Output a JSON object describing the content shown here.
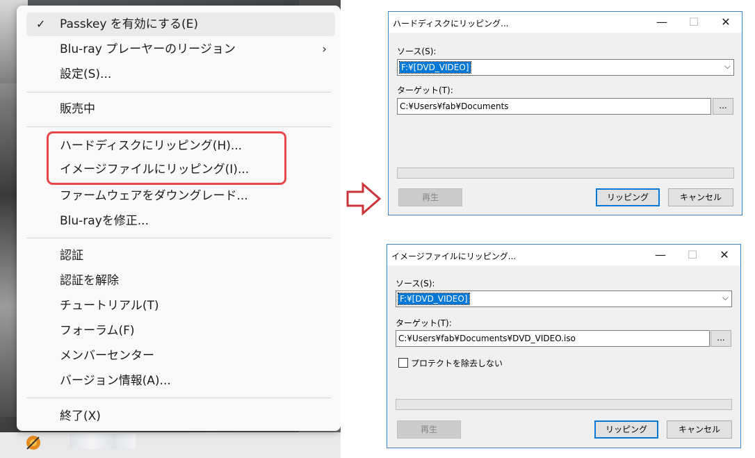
{
  "menu": {
    "items": [
      {
        "label": "Passkey を有効にする(E)",
        "checked": true
      },
      {
        "label": "Blu-ray プレーヤーのリージョン",
        "submenu": true
      },
      {
        "label": "設定(S)..."
      },
      {
        "label": "販売中"
      },
      {
        "label": "ハードディスクにリッピング(H)..."
      },
      {
        "label": "イメージファイルにリッピング(I)..."
      },
      {
        "label": "ファームウェアをダウングレード..."
      },
      {
        "label": "Blu-rayを修正..."
      },
      {
        "label": "認証"
      },
      {
        "label": "認証を解除"
      },
      {
        "label": "チュートリアル(T)"
      },
      {
        "label": "フォーラム(F)"
      },
      {
        "label": "メンバーセンター"
      },
      {
        "label": "バージョン情報(A)..."
      },
      {
        "label": "終了(X)"
      }
    ],
    "highlight_color": "#e8474a"
  },
  "arrow_color": "#c8343a",
  "dialog_hdd": {
    "title": "ハードディスクにリッピング...",
    "source_label": "ソース(S):",
    "source_value": "F:¥[DVD_VIDEO]",
    "target_label": "ターゲット(T):",
    "target_value": "C:¥Users¥fab¥Documents",
    "browse_label": "...",
    "play_label": "再生",
    "rip_label": "リッピング",
    "cancel_label": "キャンセル",
    "progress": 0
  },
  "dialog_iso": {
    "title": "イメージファイルにリッピング...",
    "source_label": "ソース(S):",
    "source_value": "F:¥[DVD_VIDEO]",
    "target_label": "ターゲット(T):",
    "target_value": "C:¥Users¥fab¥Documents¥DVD_VIDEO.iso",
    "browse_label": "...",
    "protect_label": "プロテクトを除去しない",
    "protect_checked": false,
    "play_label": "再生",
    "rip_label": "リッピング",
    "cancel_label": "キャンセル",
    "progress": 0
  },
  "caption_buttons": {
    "minimize": "—",
    "maximize": "☐",
    "close": "✕"
  },
  "accent": "#0078d7"
}
